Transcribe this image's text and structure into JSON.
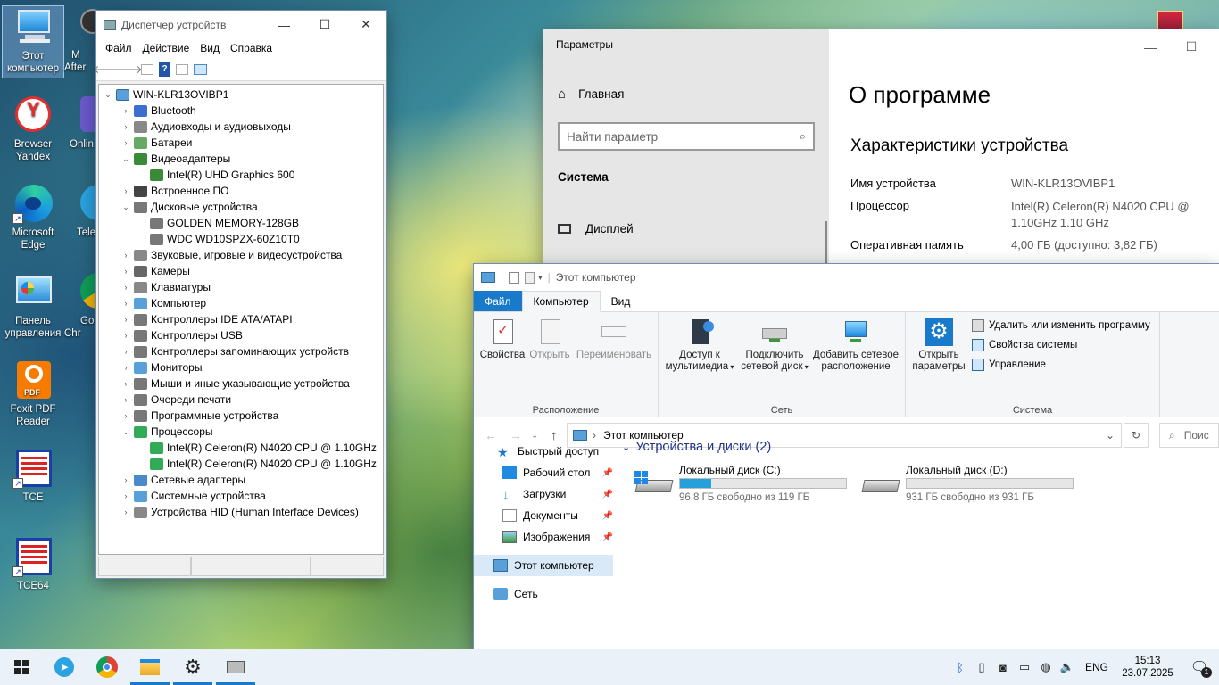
{
  "desktop": {
    "icons": [
      {
        "label": "Этот компьютер"
      },
      {
        "label": "Browser Yandex"
      },
      {
        "label": "Microsoft Edge"
      },
      {
        "label": "Панель управления"
      },
      {
        "label": "Foxit PDF Reader"
      },
      {
        "label": "TCE"
      },
      {
        "label": "TCE64"
      },
      {
        "label": "M After"
      },
      {
        "label": "Onlin"
      },
      {
        "label": "Tele"
      },
      {
        "label": "Go Chr"
      }
    ]
  },
  "device_manager": {
    "title": "Диспетчер устройств",
    "menu": [
      "Файл",
      "Действие",
      "Вид",
      "Справка"
    ],
    "root": "WIN-KLR13OVIBP1",
    "tree": [
      {
        "label": "Bluetooth",
        "expanded": false,
        "children": []
      },
      {
        "label": "Аудиовходы и аудиовыходы",
        "expanded": false,
        "children": []
      },
      {
        "label": "Батареи",
        "expanded": false,
        "children": []
      },
      {
        "label": "Видеоадаптеры",
        "expanded": true,
        "children": [
          "Intel(R) UHD Graphics 600"
        ]
      },
      {
        "label": "Встроенное ПО",
        "expanded": false,
        "children": []
      },
      {
        "label": "Дисковые устройства",
        "expanded": true,
        "children": [
          "GOLDEN MEMORY-128GB",
          "WDC WD10SPZX-60Z10T0"
        ]
      },
      {
        "label": "Звуковые, игровые и видеоустройства",
        "expanded": false,
        "children": []
      },
      {
        "label": "Камеры",
        "expanded": false,
        "children": []
      },
      {
        "label": "Клавиатуры",
        "expanded": false,
        "children": []
      },
      {
        "label": "Компьютер",
        "expanded": false,
        "children": []
      },
      {
        "label": "Контроллеры IDE ATA/ATAPI",
        "expanded": false,
        "children": []
      },
      {
        "label": "Контроллеры USB",
        "expanded": false,
        "children": []
      },
      {
        "label": "Контроллеры запоминающих устройств",
        "expanded": false,
        "children": []
      },
      {
        "label": "Мониторы",
        "expanded": false,
        "children": []
      },
      {
        "label": "Мыши и иные указывающие устройства",
        "expanded": false,
        "children": []
      },
      {
        "label": "Очереди печати",
        "expanded": false,
        "children": []
      },
      {
        "label": "Программные устройства",
        "expanded": false,
        "children": []
      },
      {
        "label": "Процессоры",
        "expanded": true,
        "children": [
          "Intel(R) Celeron(R) N4020 CPU @ 1.10GHz",
          "Intel(R) Celeron(R) N4020 CPU @ 1.10GHz"
        ]
      },
      {
        "label": "Сетевые адаптеры",
        "expanded": false,
        "children": []
      },
      {
        "label": "Системные устройства",
        "expanded": false,
        "children": []
      },
      {
        "label": "Устройства HID (Human Interface Devices)",
        "expanded": false,
        "children": []
      }
    ]
  },
  "settings": {
    "title": "Параметры",
    "home": "Главная",
    "search_placeholder": "Найти параметр",
    "section": "Система",
    "nav_display": "Дисплей",
    "page_title": "О программе",
    "specs_title": "Характеристики устройства",
    "specs": [
      {
        "key": "Имя устройства",
        "value": "WIN-KLR13OVIBP1"
      },
      {
        "key": "Процессор",
        "value": "Intel(R) Celeron(R) N4020 CPU @ 1.10GHz   1.10 GHz"
      },
      {
        "key": "Оперативная память",
        "value": "4,00 ГБ (доступно: 3,82 ГБ)"
      }
    ]
  },
  "explorer": {
    "title": "Этот компьютер",
    "tabs": [
      "Файл",
      "Компьютер",
      "Вид"
    ],
    "ribbon": {
      "loc_group": "Расположение",
      "net_group": "Сеть",
      "sys_group": "Система",
      "properties": "Свойства",
      "open": "Открыть",
      "rename": "Переименовать",
      "media1": "Доступ к",
      "media2": "мультимедиа",
      "mapdrive1": "Подключить",
      "mapdrive2": "сетевой диск",
      "addloc1": "Добавить сетевое",
      "addloc2": "расположение",
      "openset1": "Открыть",
      "openset2": "параметры",
      "uninstall": "Удалить или изменить программу",
      "sysprops": "Свойства системы",
      "manage": "Управление"
    },
    "address": "Этот компьютер",
    "search_placeholder": "Поис",
    "nav": {
      "quick": "Быстрый доступ",
      "desktop": "Рабочий стол",
      "downloads": "Загрузки",
      "documents": "Документы",
      "pictures": "Изображения",
      "thispc": "Этот компьютер",
      "network": "Сеть"
    },
    "group_header": "Устройства и диски (2)",
    "drives": [
      {
        "name": "Локальный диск (C:)",
        "free": "96,8 ГБ свободно из 119 ГБ",
        "used_fraction": 0.19
      },
      {
        "name": "Локальный диск (D:)",
        "free": "931 ГБ свободно из 931 ГБ",
        "used_fraction": 0.0
      }
    ]
  },
  "taskbar": {
    "lang": "ENG",
    "time": "15:13",
    "date": "23.07.2025",
    "notif_count": "1"
  }
}
